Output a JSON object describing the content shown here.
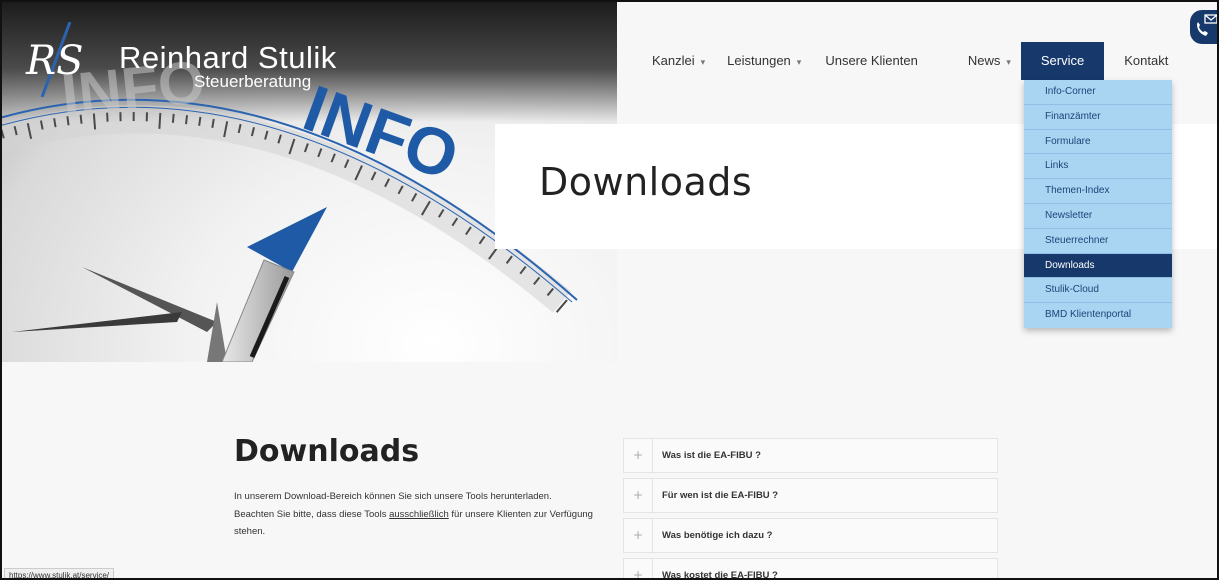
{
  "brand": {
    "monogram": "RS",
    "name": "Reinhard Stulik",
    "subtitle": "Steuerberatung"
  },
  "hero": {
    "dial_text_large": "INFO",
    "dial_text_faded": "INFO"
  },
  "nav": {
    "items": [
      {
        "label": "Kanzlei",
        "has_caret": true
      },
      {
        "label": "Leistungen",
        "has_caret": true
      },
      {
        "label": "Unsere Klienten",
        "has_caret": false
      },
      {
        "label": "News",
        "has_caret": true
      },
      {
        "label": "Service",
        "has_caret": false,
        "active": true
      },
      {
        "label": "Kontakt",
        "has_caret": false
      }
    ],
    "caret": "▾"
  },
  "service_menu": {
    "items": [
      "Info-Corner",
      "Finanzämter",
      "Formulare",
      "Links",
      "Themen-Index",
      "Newsletter",
      "Steuerrechner",
      "Downloads",
      "Stulik-Cloud",
      "BMD Klientenportal"
    ],
    "active_index": 7
  },
  "page_title": "Downloads",
  "content": {
    "heading": "Downloads",
    "text_before_link": "In unserem Download-Bereich können Sie sich unsere Tools herunterladen. Beachten Sie bitte, dass diese Tools ",
    "emphasis": "ausschließlich",
    "text_after_link": " für unsere Klienten zur Verfügung stehen."
  },
  "faq": {
    "plus_symbol": "+",
    "items": [
      "Was ist die EA-FIBU ?",
      "Für wen ist die EA-FIBU ?",
      "Was benötige ich dazu ?",
      "Was kostet die EA-FIBU ?"
    ]
  },
  "status_bar_url": "https://www.stulik.at/service/",
  "colors": {
    "brand_navy": "#17386b",
    "dropdown_bg": "#a9d4f2",
    "dial_blue": "#1f5aa6"
  },
  "icons": {
    "contact": "phone-mail-icon",
    "accordion": "plus-icon"
  }
}
